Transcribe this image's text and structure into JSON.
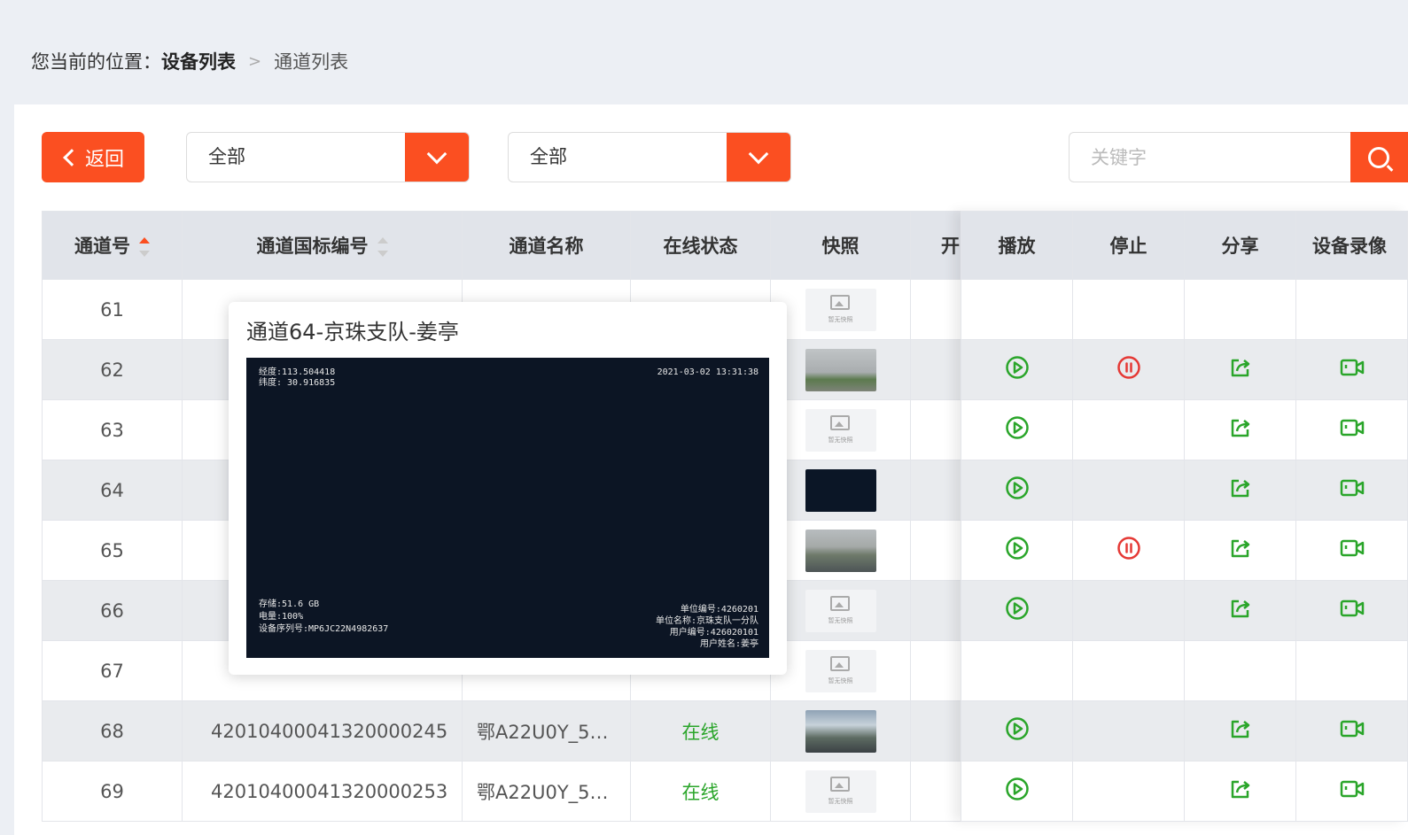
{
  "breadcrumb": {
    "prefix": "您当前的位置：",
    "current": "设备列表",
    "last": "通道列表"
  },
  "toolbar": {
    "back_label": "返回",
    "filter1_value": "全部",
    "filter2_value": "全部",
    "search_placeholder": "关键字"
  },
  "table": {
    "headers": {
      "channel_no": "通道号",
      "gb_code": "通道国标编号",
      "name": "通道名称",
      "status": "在线状态",
      "snapshot": "快照",
      "toggle": "开",
      "play": "播放",
      "stop": "停止",
      "share": "分享",
      "record": "设备录像"
    },
    "snapshot_placeholder": "暂无快照",
    "rows": [
      {
        "no": "61",
        "code": "",
        "name": "",
        "status": "",
        "thumb": "none",
        "play": false,
        "stop": false
      },
      {
        "no": "62",
        "code": "",
        "name": "",
        "status": "",
        "thumb": "fog",
        "play": true,
        "stop": true
      },
      {
        "no": "63",
        "code": "",
        "name": "",
        "status": "",
        "thumb": "none",
        "play": true,
        "stop": false
      },
      {
        "no": "64",
        "code": "",
        "name": "",
        "status": "",
        "thumb": "dark",
        "play": true,
        "stop": false
      },
      {
        "no": "65",
        "code": "",
        "name": "",
        "status": "",
        "thumb": "road",
        "play": true,
        "stop": true
      },
      {
        "no": "66",
        "code": "",
        "name": "",
        "status": "",
        "thumb": "none",
        "play": true,
        "stop": false
      },
      {
        "no": "67",
        "code": "",
        "name": "",
        "status": "",
        "thumb": "none",
        "play": false,
        "stop": false
      },
      {
        "no": "68",
        "code": "42010400041320000245",
        "name": "鄂A22U0Y_5…",
        "status": "在线",
        "thumb": "street",
        "play": true,
        "stop": false
      },
      {
        "no": "69",
        "code": "42010400041320000253",
        "name": "鄂A22U0Y_5…",
        "status": "在线",
        "thumb": "none",
        "play": true,
        "stop": false
      }
    ]
  },
  "popup": {
    "title": "通道64-京珠支队-姜亭",
    "overlay": {
      "lon": "经度:113.504418",
      "lat": "纬度: 30.916835",
      "datetime": "2021-03-02  13:31:38",
      "storage": "存储:51.6 GB",
      "battery": "电量:100%",
      "serial": "设备序列号:MP6JC22N4982637",
      "unit_no": "单位编号:4260201",
      "unit_name": "单位名称:京珠支队一分队",
      "user_no": "用户编号:426020101",
      "user_name": "用户姓名:姜亭"
    }
  },
  "colors": {
    "accent": "#fb4f21",
    "play": "#2aa52a",
    "stop": "#e53935"
  }
}
